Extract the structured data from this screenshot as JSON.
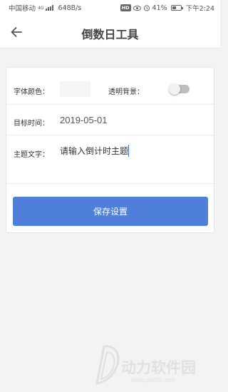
{
  "status_bar": {
    "carrier": "中国移动",
    "network": "4G",
    "speed": "648B/s",
    "hd": "HD",
    "battery": "41%",
    "battery_level": 0.41,
    "time": "下午2:24"
  },
  "nav": {
    "back_icon": "arrow-left-icon",
    "title": "倒数日工具"
  },
  "settings": {
    "font_color_label": "字体颜色：",
    "font_color_value": "#f5f5f5",
    "transparent_bg_label": "透明背景：",
    "transparent_bg_enabled": false,
    "target_time_label": "目标时间：",
    "target_time_value": "2019-05-01",
    "theme_text_label": "主题文字：",
    "theme_text_placeholder": "请输入倒计时主题",
    "save_button": "保存设置"
  },
  "colors": {
    "accent": "#4f7fd9",
    "toggle_off": "#bdbdbd"
  },
  "watermark": {
    "text": "动力软件园",
    "url": "www.pw88.com"
  }
}
